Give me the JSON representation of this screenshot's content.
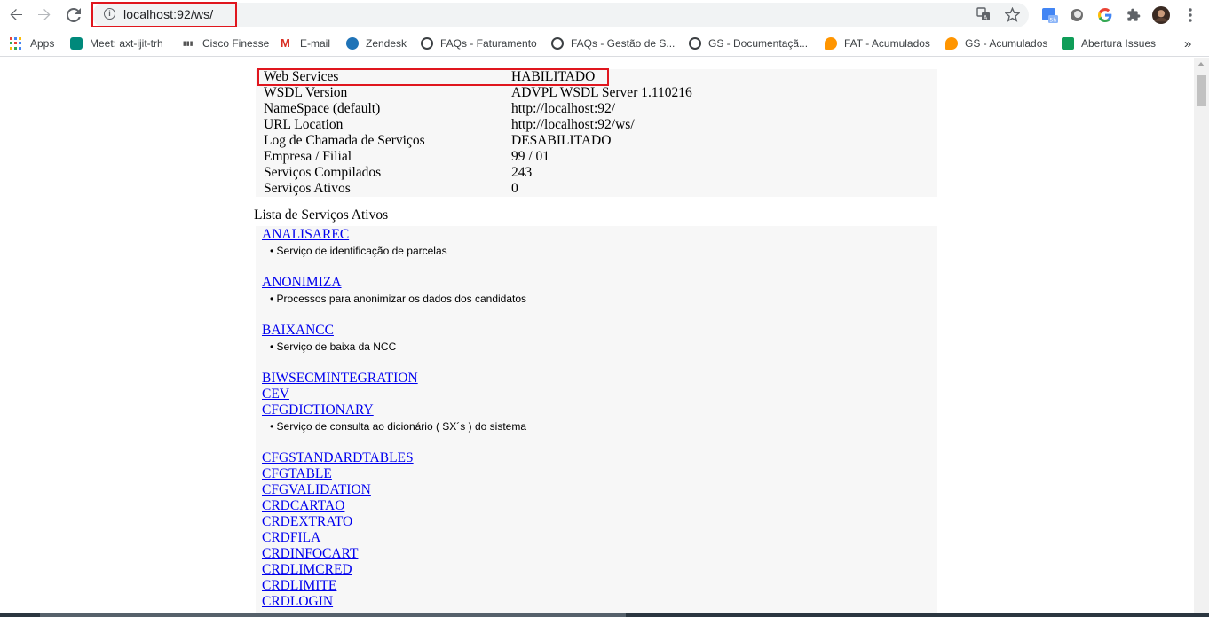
{
  "browser": {
    "url": "localhost:92/ws/",
    "bookmarks": [
      {
        "label": "Apps",
        "icon": "apps-grid-icon"
      },
      {
        "label": "Meet: axt-ijit-trh",
        "icon": "meet-icon",
        "color": "#00897b"
      },
      {
        "label": "Cisco Finesse",
        "icon": "cisco-icon",
        "color": "#555555"
      },
      {
        "label": "E-mail",
        "icon": "gmail-icon",
        "color": "#d93025"
      },
      {
        "label": "Zendesk",
        "icon": "zendesk-icon",
        "color": "#1f73b7"
      },
      {
        "label": "FAQs - Faturamento",
        "icon": "faq-icon",
        "color": "#3c4043"
      },
      {
        "label": "FAQs - Gestão de S...",
        "icon": "faq-icon",
        "color": "#3c4043"
      },
      {
        "label": "GS - Documentaçã...",
        "icon": "faq-icon",
        "color": "#3c4043"
      },
      {
        "label": "FAT - Acumulados",
        "icon": "firefox-icon",
        "color": "#ff9500"
      },
      {
        "label": "GS - Acumulados",
        "icon": "firefox-icon",
        "color": "#ff9500"
      },
      {
        "label": "Abertura Issues",
        "icon": "sheets-icon",
        "color": "#0f9d58"
      }
    ],
    "overflow": "»"
  },
  "info": [
    {
      "key": "Web Services",
      "value": "HABILITADO"
    },
    {
      "key": "WSDL Version",
      "value": "ADVPL WSDL Server 1.110216"
    },
    {
      "key": "NameSpace (default)",
      "value": "http://localhost:92/"
    },
    {
      "key": "URL Location",
      "value": "http://localhost:92/ws/"
    },
    {
      "key": "Log de Chamada de Serviços",
      "value": "DESABILITADO"
    },
    {
      "key": "Empresa / Filial",
      "value": "99 / 01"
    },
    {
      "key": "Serviços Compilados",
      "value": "243"
    },
    {
      "key": "Serviços Ativos",
      "value": "0"
    }
  ],
  "services_title": "Lista de Serviços Ativos",
  "services": [
    {
      "name": "ANALISAREC",
      "desc": "• Serviço de identificação de parcelas"
    },
    {
      "name": "ANONIMIZA",
      "desc": "• Processos para anonimizar os dados dos candidatos"
    },
    {
      "name": "BAIXANCC",
      "desc": "• Serviço de baixa da NCC"
    },
    {
      "name": "BIWSECMINTEGRATION"
    },
    {
      "name": "CEV"
    },
    {
      "name": "CFGDICTIONARY",
      "desc": "• Serviço de consulta ao dicionário ( SX´s ) do sistema"
    },
    {
      "name": "CFGSTANDARDTABLES"
    },
    {
      "name": "CFGTABLE"
    },
    {
      "name": "CFGVALIDATION"
    },
    {
      "name": "CRDCARTAO"
    },
    {
      "name": "CRDEXTRATO"
    },
    {
      "name": "CRDFILA"
    },
    {
      "name": "CRDINFOCART"
    },
    {
      "name": "CRDLIMCRED"
    },
    {
      "name": "CRDLIMITE"
    },
    {
      "name": "CRDLOGIN"
    }
  ],
  "colors": {
    "highlight": "#e0161e",
    "link": "#0000ee",
    "panel": "#f7f7f7"
  }
}
